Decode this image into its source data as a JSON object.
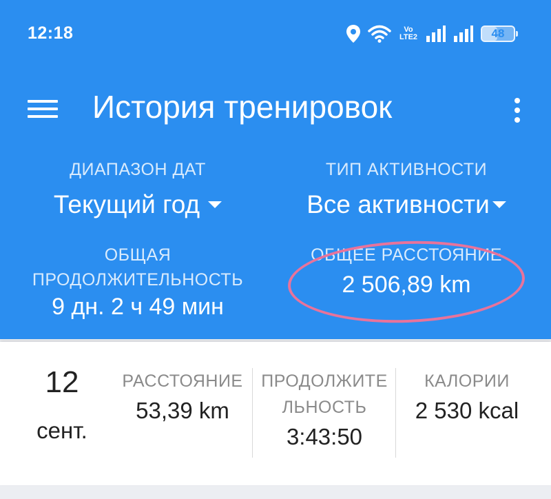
{
  "status_bar": {
    "time": "12:18",
    "network_label": "Vo LTE2",
    "battery": "48",
    "icons": [
      "location-icon",
      "wifi-icon",
      "volte-icon",
      "signal-icon",
      "signal-icon",
      "battery-icon"
    ]
  },
  "toolbar": {
    "title": "История тренировок",
    "menu_icon": "hamburger-menu-icon",
    "more_icon": "more-vert-icon"
  },
  "filters": {
    "date_range": {
      "label": "ДИАПАЗОН ДАТ",
      "value": "Текущий год"
    },
    "activity_type": {
      "label": "ТИП АКТИВНОСТИ",
      "value": "Все активности"
    }
  },
  "summary": {
    "total_duration": {
      "label_line1": "ОБЩАЯ",
      "label_line2": "ПРОДОЛЖИТЕЛЬНОСТЬ",
      "value": "9 дн. 2 ч 49 мин"
    },
    "total_distance": {
      "label": "ОБЩЕЕ РАССТОЯНИЕ",
      "value": "2 506,89 km"
    }
  },
  "annotation_color": "#e8739b",
  "accent_color": "#2b8ef0",
  "workout": {
    "day": "12",
    "month": "сент.",
    "distance": {
      "label": "РАССТОЯНИЕ",
      "value": "53,39 km"
    },
    "duration": {
      "label_line1": "ПРОДОЛЖИТЕ",
      "label_line2": "ЛЬНОСТЬ",
      "value": "3:43:50"
    },
    "calories": {
      "label": "КАЛОРИИ",
      "value": "2 530 kcal"
    }
  }
}
